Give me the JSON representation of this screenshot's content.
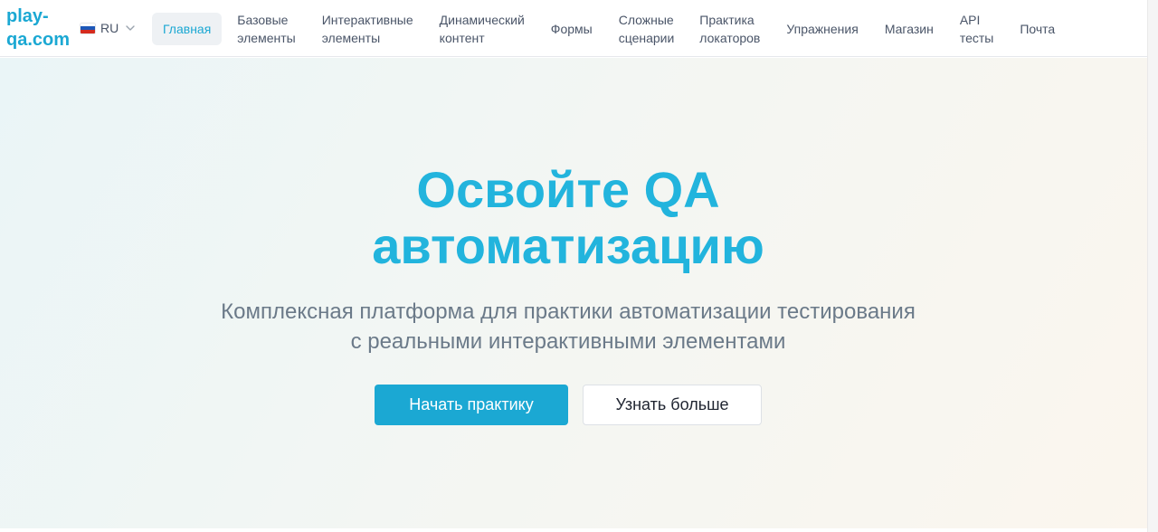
{
  "header": {
    "logo": "play-\nqa.com",
    "language": {
      "code": "RU",
      "flag": "russia-flag-icon"
    },
    "nav": [
      {
        "id": "home",
        "label": "Главная",
        "active": true
      },
      {
        "id": "basic",
        "label": "Базовые\nэлементы",
        "active": false
      },
      {
        "id": "interactive",
        "label": "Интерактивные\nэлементы",
        "active": false
      },
      {
        "id": "dynamic",
        "label": "Динамический\nконтент",
        "active": false
      },
      {
        "id": "forms",
        "label": "Формы",
        "active": false
      },
      {
        "id": "complex",
        "label": "Сложные\nсценарии",
        "active": false
      },
      {
        "id": "locators",
        "label": "Практика\nлокаторов",
        "active": false
      },
      {
        "id": "exercises",
        "label": "Упражнения",
        "active": false
      },
      {
        "id": "shop",
        "label": "Магазин",
        "active": false
      },
      {
        "id": "api",
        "label": "API\nтесты",
        "active": false
      },
      {
        "id": "mail",
        "label": "Почта",
        "active": false
      }
    ]
  },
  "hero": {
    "title_line1": "Освойте QA",
    "title_line2": "автоматизацию",
    "subtitle_line1": "Комплексная платформа для практики автоматизации тестирования",
    "subtitle_line2": "с реальными интерактивными элементами",
    "primary_button": "Начать практику",
    "secondary_button": "Узнать больше"
  },
  "colors": {
    "accent": "#1ba8d3",
    "title": "#22b4dd",
    "text_muted": "#6b7a89",
    "nav_text": "#4a5568"
  }
}
